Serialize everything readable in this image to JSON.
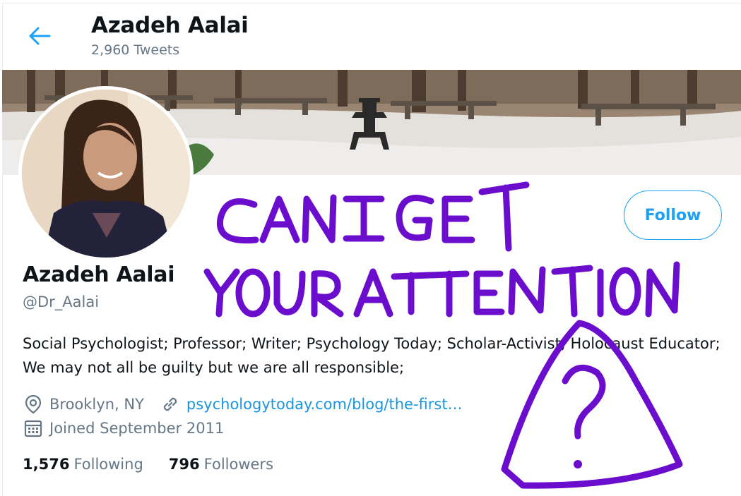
{
  "header": {
    "title": "Azadeh Aalai",
    "tweet_count": "2,960 Tweets"
  },
  "profile": {
    "name": "Azadeh Aalai",
    "handle": "@Dr_Aalai",
    "bio": "Social Psychologist; Professor; Writer; Psychology Today; Scholar-Activist; Holocaust Educator; We may not all be guilty but we are all responsible;",
    "location": "Brooklyn, NY",
    "website": "psychologytoday.com/blog/the-first…",
    "joined": "Joined September 2011",
    "follow_label": "Follow"
  },
  "stats": {
    "following_count": "1,576",
    "following_label": "Following",
    "followers_count": "796",
    "followers_label": "Followers"
  },
  "annotation": {
    "line1": "CAN I GET",
    "line2": "YOUR ATTENTION",
    "mark": "?"
  },
  "colors": {
    "accent": "#1da1f2",
    "link": "#1b95e0",
    "muted": "#657786",
    "scribble": "#6a0dcc"
  },
  "icons": [
    "back-arrow-icon",
    "location-pin-icon",
    "link-icon",
    "calendar-icon"
  ]
}
